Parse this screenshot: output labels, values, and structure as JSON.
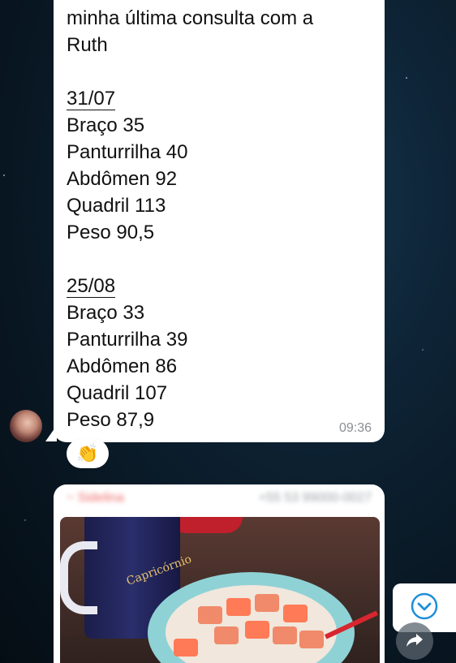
{
  "message": {
    "lines_intro": [
      "minha última consulta com a",
      "Ruth"
    ],
    "entries": [
      {
        "date": "31/07",
        "measures": [
          "Braço 35",
          "Panturrilha 40",
          "Abdômen 92",
          "Quadril 113",
          "Peso 90,5"
        ]
      },
      {
        "date": "25/08",
        "measures": [
          "Braço 33",
          "Panturrilha 39",
          "Abdômen 86",
          "Quadril 107",
          "Peso 87,9"
        ]
      }
    ],
    "time": "09:36",
    "reaction": "👏"
  },
  "next_message": {
    "sender_name": "~ Sidelina",
    "sender_phone": "+55 53 99000-0027",
    "photo_label": "Capricórnio"
  },
  "icons": {
    "scroll_down": "chevron-down-circle-icon",
    "forward": "forward-icon"
  },
  "colors": {
    "accent": "#1e8fd8",
    "sender_name": "#f06b6b"
  }
}
